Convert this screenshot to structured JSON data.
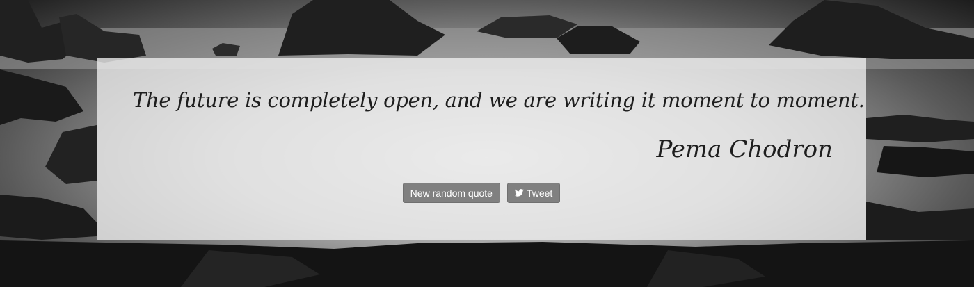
{
  "quote": {
    "text": "The future is completely open, and we are writing it moment to moment.",
    "author": "Pema Chodron"
  },
  "actions": {
    "new_quote_label": "New random quote",
    "tweet_label": "Tweet",
    "tweet_icon": "twitter-bird-icon"
  },
  "colors": {
    "button_bg": "#808080",
    "text": "#1e1e1e",
    "panel": "#f0f0f0"
  }
}
